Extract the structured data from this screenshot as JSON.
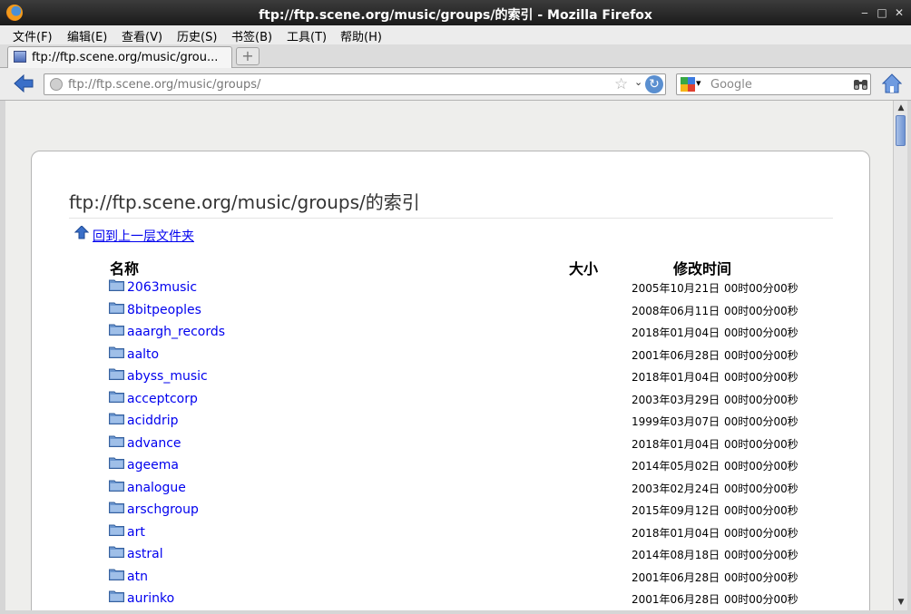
{
  "window": {
    "title": "ftp://ftp.scene.org/music/groups/的索引 - Mozilla Firefox",
    "min_glyph": "‒",
    "max_glyph": "□",
    "close_glyph": "✕"
  },
  "menu": [
    "文件(F)",
    "编辑(E)",
    "查看(V)",
    "历史(S)",
    "书签(B)",
    "工具(T)",
    "帮助(H)"
  ],
  "tab": {
    "label": "ftp://ftp.scene.org/music/grou...",
    "new_tab_glyph": "+"
  },
  "navbar": {
    "url": "ftp://ftp.scene.org/music/groups/",
    "star_glyph": "☆",
    "drop_glyph": "⌄",
    "reload_glyph": "↻",
    "search_placeholder": "Google",
    "search_drop_glyph": "▾"
  },
  "page": {
    "heading": "ftp://ftp.scene.org/music/groups/的索引",
    "up_link": "回到上一层文件夹",
    "columns": {
      "name": "名称",
      "size": "大小",
      "modified": "修改时间"
    },
    "rows": [
      {
        "name": "2063music",
        "date": "2005年10月21日",
        "time": "00时00分00秒"
      },
      {
        "name": "8bitpeoples",
        "date": "2008年06月11日",
        "time": "00时00分00秒"
      },
      {
        "name": "aaargh_records",
        "date": "2018年01月04日",
        "time": "00时00分00秒"
      },
      {
        "name": "aalto",
        "date": "2001年06月28日",
        "time": "00时00分00秒"
      },
      {
        "name": "abyss_music",
        "date": "2018年01月04日",
        "time": "00时00分00秒"
      },
      {
        "name": "acceptcorp",
        "date": "2003年03月29日",
        "time": "00时00分00秒"
      },
      {
        "name": "aciddrip",
        "date": "1999年03月07日",
        "time": "00时00分00秒"
      },
      {
        "name": "advance",
        "date": "2018年01月04日",
        "time": "00时00分00秒"
      },
      {
        "name": "ageema",
        "date": "2014年05月02日",
        "time": "00时00分00秒"
      },
      {
        "name": "analogue",
        "date": "2003年02月24日",
        "time": "00时00分00秒"
      },
      {
        "name": "arschgroup",
        "date": "2015年09月12日",
        "time": "00时00分00秒"
      },
      {
        "name": "art",
        "date": "2018年01月04日",
        "time": "00时00分00秒"
      },
      {
        "name": "astral",
        "date": "2014年08月18日",
        "time": "00时00分00秒"
      },
      {
        "name": "atn",
        "date": "2001年06月28日",
        "time": "00时00分00秒"
      },
      {
        "name": "aurinko",
        "date": "2001年06月28日",
        "time": "00时00分00秒"
      }
    ]
  },
  "colors": {
    "link": "#0000ee",
    "titlebar": "#2a2a2a",
    "accent": "#3a6fc8"
  }
}
